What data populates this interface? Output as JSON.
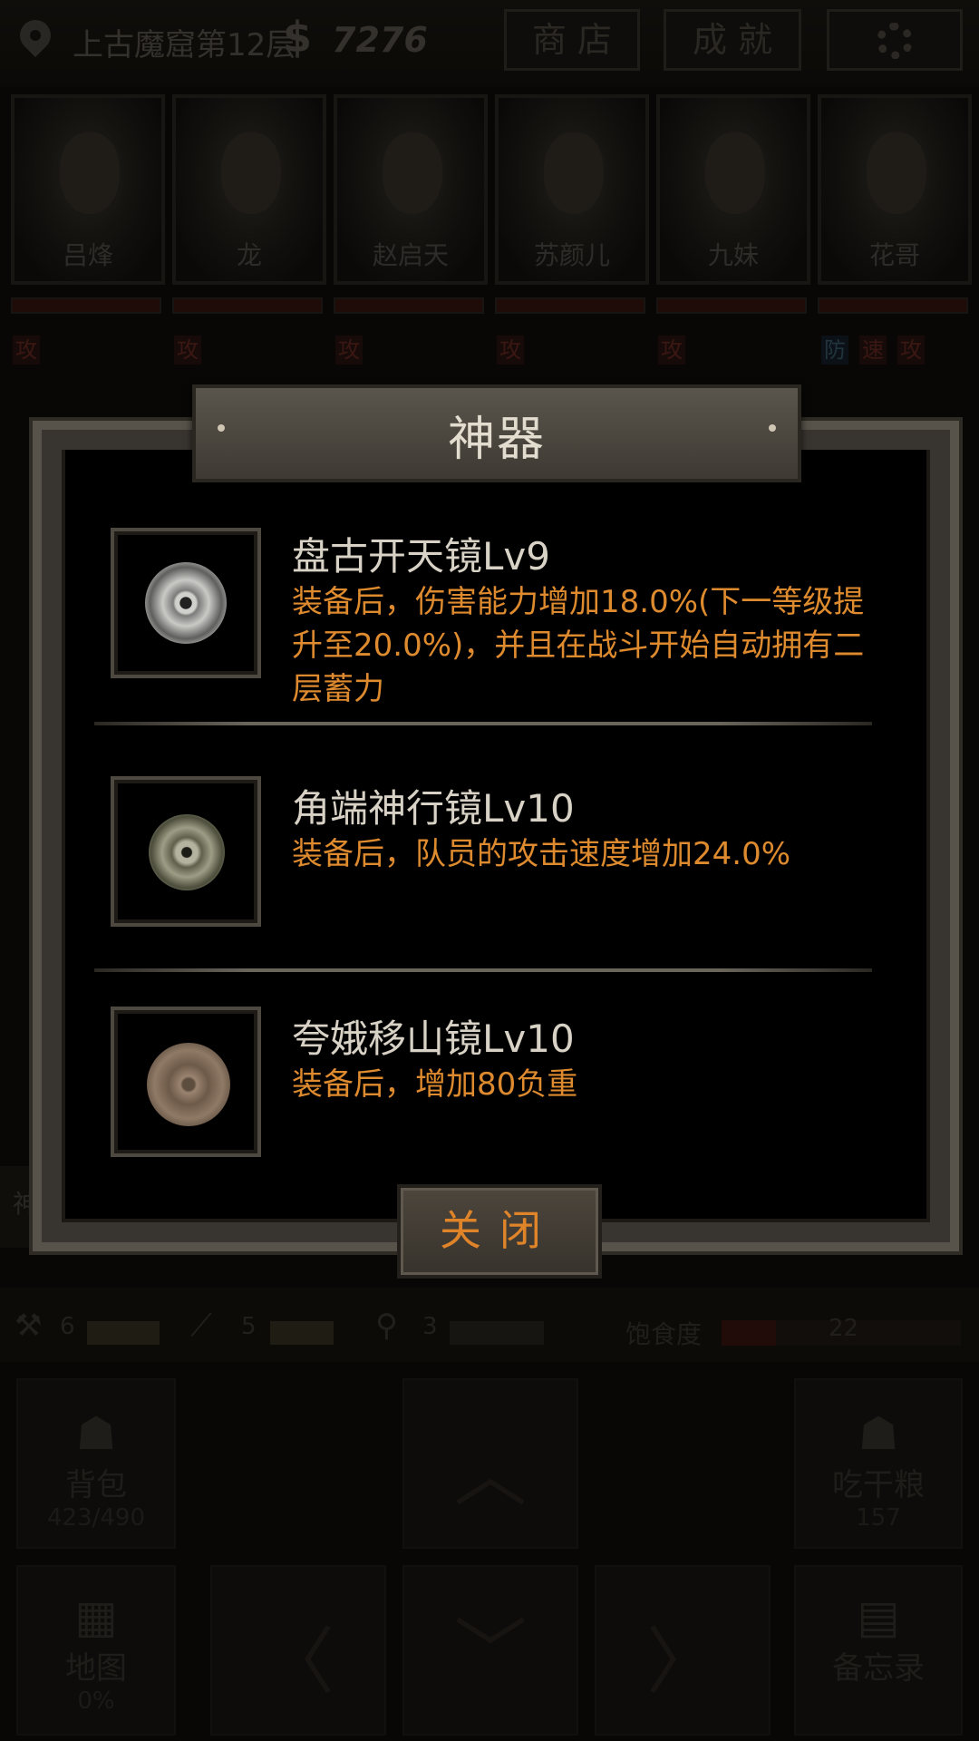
{
  "top_bar": {
    "location": "上古魔窟第12层",
    "currency_symbol": "$",
    "money": "7276",
    "shop_label": "商 店",
    "achievements_label": "成 就"
  },
  "team": [
    {
      "name": "吕烽",
      "tags": [
        "攻"
      ]
    },
    {
      "name": "龙",
      "tags": [
        "攻"
      ]
    },
    {
      "name": "赵启天",
      "tags": [
        "攻"
      ]
    },
    {
      "name": "苏颜儿",
      "tags": [
        "攻"
      ]
    },
    {
      "name": "九妹",
      "tags": [
        "攻"
      ]
    },
    {
      "name": "花哥",
      "tags": [
        "防",
        "速",
        "攻"
      ]
    }
  ],
  "side_button": {
    "label": "神"
  },
  "stats": {
    "axe_count": "6",
    "pickaxe_count": "5",
    "shovel_count": "3",
    "satiety_label": "饱食度",
    "satiety_value": "22"
  },
  "bottom_menu": {
    "backpack": {
      "label": "背包",
      "value": "423/490"
    },
    "eat": {
      "label": "吃干粮",
      "value": "157"
    },
    "map": {
      "label": "地图",
      "value": "0%"
    },
    "memo": {
      "label": "备忘录"
    }
  },
  "modal": {
    "title": "神器",
    "items": [
      {
        "name": "盘古开天镜Lv9",
        "description": "装备后，伤害能力增加18.0%(下一等级提升至20.0%)，并且在战斗开始自动拥有二层蓄力",
        "icon": "silver-mirror-icon"
      },
      {
        "name": "角端神行镜Lv10",
        "description": "装备后，队员的攻击速度增加24.0%",
        "icon": "bronze-mirror-icon"
      },
      {
        "name": "夸娥移山镜Lv10",
        "description": "装备后，增加80负重",
        "icon": "copper-mirror-icon"
      }
    ],
    "close_label": "关闭"
  }
}
